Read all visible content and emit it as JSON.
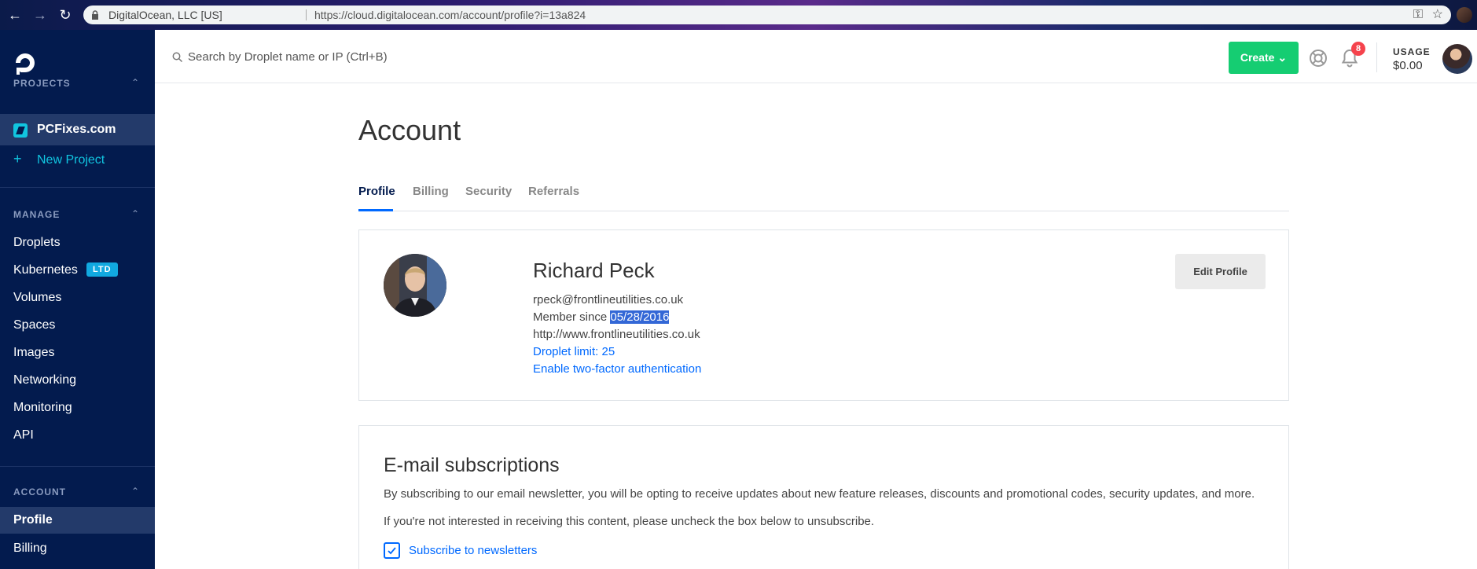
{
  "browser": {
    "site_identity": "DigitalOcean, LLC [US]",
    "url": "https://cloud.digitalocean.com/account/profile?i=13a824"
  },
  "sidebar": {
    "projects_label": "PROJECTS",
    "current_project": "PCFixes.com",
    "new_project_label": "New Project",
    "manage_label": "MANAGE",
    "manage_items": [
      {
        "label": "Droplets"
      },
      {
        "label": "Kubernetes",
        "badge": "LTD"
      },
      {
        "label": "Volumes"
      },
      {
        "label": "Spaces"
      },
      {
        "label": "Images"
      },
      {
        "label": "Networking"
      },
      {
        "label": "Monitoring"
      },
      {
        "label": "API"
      }
    ],
    "account_label": "ACCOUNT",
    "account_items": [
      {
        "label": "Profile",
        "active": true
      },
      {
        "label": "Billing"
      }
    ]
  },
  "header": {
    "search_placeholder": "Search by Droplet name or IP (Ctrl+B)",
    "create_label": "Create",
    "notification_count": "8",
    "usage_label": "USAGE",
    "usage_value": "$0.00"
  },
  "page": {
    "title": "Account",
    "tabs": [
      {
        "label": "Profile",
        "active": true
      },
      {
        "label": "Billing"
      },
      {
        "label": "Security"
      },
      {
        "label": "Referrals"
      }
    ]
  },
  "profile": {
    "name": "Richard Peck",
    "email": "rpeck@frontlineutilities.co.uk",
    "member_since_prefix": "Member since",
    "member_since_date": "05/28/2016",
    "website": "http://www.frontlineutilities.co.uk",
    "droplet_limit": "Droplet limit: 25",
    "two_factor": "Enable two-factor authentication",
    "edit_label": "Edit Profile"
  },
  "email_subscriptions": {
    "title": "E-mail subscriptions",
    "description": "By subscribing to our email newsletter, you will be opting to receive updates about new feature releases, discounts and promotional codes, security updates, and more.",
    "unsubscribe_note": "If you're not interested in receiving this content, please uncheck the box below to unsubscribe.",
    "checkbox_label": "Subscribe to newsletters",
    "checked": true
  },
  "colors": {
    "sidebar_bg": "#031b4e",
    "accent_blue": "#0069ff",
    "create_green": "#15cd72",
    "badge_red": "#f5434c"
  }
}
